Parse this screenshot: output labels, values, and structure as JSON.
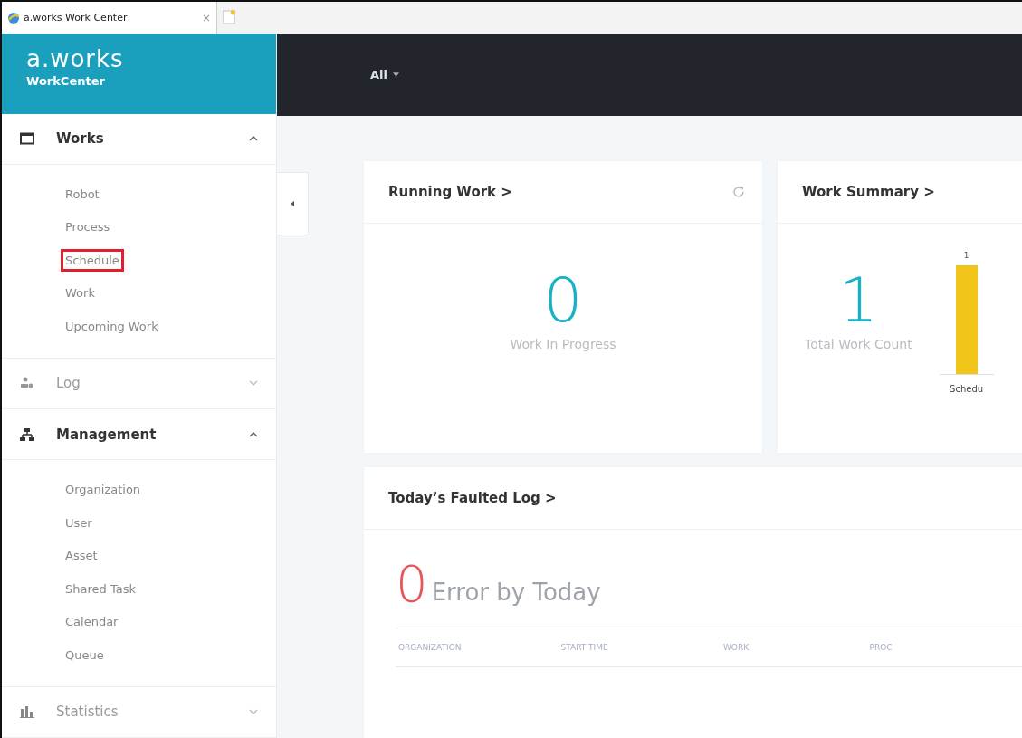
{
  "browser_tab": {
    "title": "a.works Work Center",
    "close": "×"
  },
  "brand": {
    "logo": "a.works",
    "subtitle": "WorkCenter"
  },
  "sidebar": {
    "sections": [
      {
        "kind": "calendar",
        "label": "Works",
        "expanded": true,
        "items": [
          {
            "label": "Robot",
            "highlighted": false
          },
          {
            "label": "Process",
            "highlighted": false
          },
          {
            "label": "Schedule",
            "highlighted": true
          },
          {
            "label": "Work",
            "highlighted": false
          },
          {
            "label": "Upcoming Work",
            "highlighted": false
          }
        ]
      },
      {
        "kind": "users",
        "label": "Log",
        "expanded": false
      },
      {
        "kind": "hierarchy",
        "label": "Management",
        "expanded": true,
        "items": [
          {
            "label": "Organization",
            "highlighted": false
          },
          {
            "label": "User",
            "highlighted": false
          },
          {
            "label": "Asset",
            "highlighted": false
          },
          {
            "label": "Shared Task",
            "highlighted": false
          },
          {
            "label": "Calendar",
            "highlighted": false
          },
          {
            "label": "Queue",
            "highlighted": false
          }
        ]
      },
      {
        "kind": "chart",
        "label": "Statistics",
        "expanded": false
      }
    ]
  },
  "topbar": {
    "filter": "All"
  },
  "running_work": {
    "title": "Running Work >",
    "value": "0",
    "caption": "Work In Progress"
  },
  "work_summary": {
    "title": "Work Summary >",
    "value": "1",
    "caption": "Total Work Count",
    "chart_data": {
      "type": "bar",
      "categories": [
        "Schedu"
      ],
      "values": [
        1
      ],
      "data_labels": true
    }
  },
  "faulted_log": {
    "title": "Today’s Faulted Log >",
    "value": "0",
    "caption": "Error by Today",
    "columns": [
      "ORGANIZATION",
      "START TIME",
      "WORK",
      "PROC"
    ]
  }
}
